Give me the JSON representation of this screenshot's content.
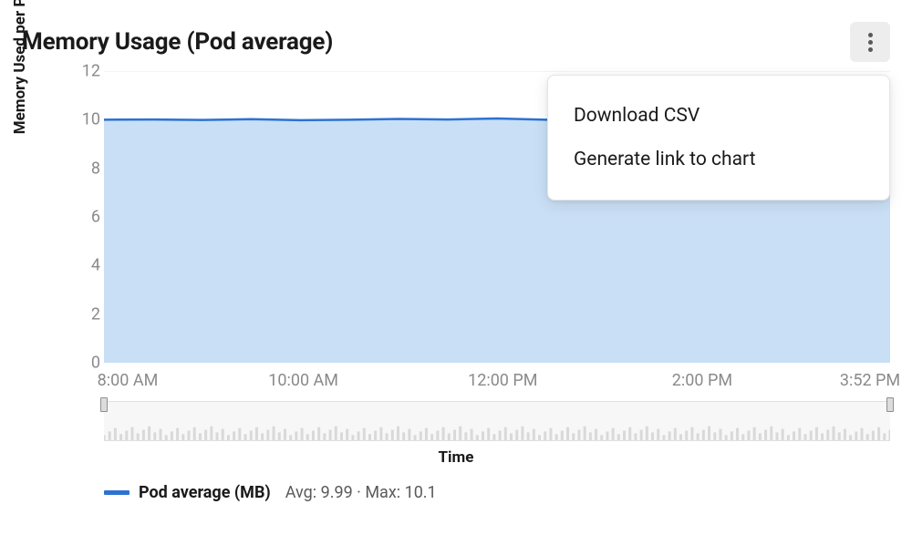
{
  "header": {
    "title": "Memory Usage (Pod average)"
  },
  "dropdown": {
    "items": [
      {
        "label": "Download CSV"
      },
      {
        "label": "Generate link to chart"
      }
    ]
  },
  "chart": {
    "ylabel": "Memory Used per Pod (MB)",
    "xlabel": "Time",
    "yticks": [
      "0",
      "2",
      "4",
      "6",
      "8",
      "10",
      "12"
    ],
    "xticks": [
      "8:00 AM",
      "10:00 AM",
      "12:00 PM",
      "2:00 PM",
      "3:52 PM"
    ]
  },
  "legend": {
    "series_name": "Pod average (MB)",
    "stats": "Avg: 9.99 · Max: 10.1"
  },
  "chart_data": {
    "type": "area",
    "title": "Memory Usage (Pod average)",
    "xlabel": "Time",
    "ylabel": "Memory Used per Pod (MB)",
    "ylim": [
      0,
      12
    ],
    "x_ticks": [
      "8:00 AM",
      "10:00 AM",
      "12:00 PM",
      "2:00 PM",
      "3:52 PM"
    ],
    "series": [
      {
        "name": "Pod average (MB)",
        "avg": 9.99,
        "max": 10.1,
        "x": [
          "8:00 AM",
          "8:30 AM",
          "9:00 AM",
          "9:30 AM",
          "10:00 AM",
          "10:30 AM",
          "11:00 AM",
          "11:30 AM",
          "12:00 PM",
          "12:30 PM",
          "1:00 PM",
          "1:30 PM",
          "2:00 PM",
          "2:30 PM",
          "3:00 PM",
          "3:30 PM",
          "3:52 PM"
        ],
        "values": [
          10.0,
          10.01,
          9.99,
          10.02,
          9.98,
          10.0,
          10.03,
          10.01,
          10.05,
          10.0,
          9.99,
          10.0,
          10.01,
          9.99,
          10.0,
          10.0,
          10.0
        ]
      }
    ],
    "colors": {
      "line": "#2d72d2",
      "fill": "#c9dff5"
    }
  }
}
